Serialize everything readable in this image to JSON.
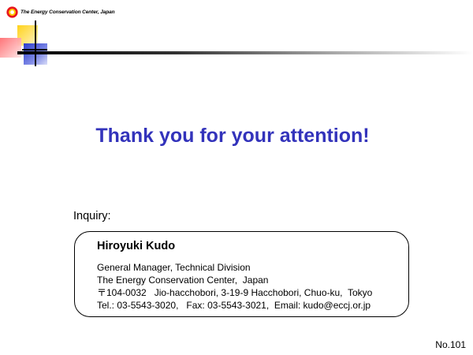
{
  "header": {
    "logo_text": "The Energy Conservation Center, Japan"
  },
  "title": "Thank you for your attention!",
  "inquiry": {
    "label": "Inquiry:"
  },
  "contact": {
    "name": "Hiroyuki Kudo",
    "position": "General Manager, Technical Division",
    "organization": "The Energy Conservation Center,  Japan",
    "address": "〒104-0032   Jio-hacchobori, 3-19-9 Hacchobori, Chuo-ku,  Tokyo",
    "tel_label": "Tel.: ",
    "tel": "03-5543-3020,",
    "fax_label": "   Fax: ",
    "fax": "03-5543-3021,",
    "email_label": "  Email: ",
    "email": "kudo@eccj.or.jp"
  },
  "footer": {
    "page_number": "No.101"
  },
  "colors": {
    "title": "#3333bb",
    "logo_red": "#e8161c",
    "logo_yellow": "#ffcc00",
    "deco_blue": "#3344cc",
    "deco_bar": "#000000"
  }
}
